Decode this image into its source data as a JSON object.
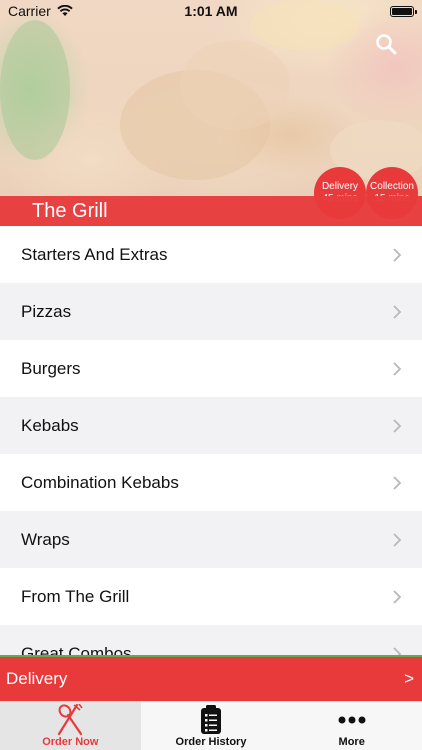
{
  "status_bar": {
    "carrier": "Carrier",
    "time": "1:01 AM"
  },
  "header": {
    "restaurant_name": "The Grill",
    "delivery_badge": {
      "label": "Delivery",
      "time": "45 mins"
    },
    "collection_badge": {
      "label": "Collection",
      "time": "15 mins"
    },
    "search_icon": "search-icon"
  },
  "menu": {
    "categories": [
      {
        "label": "Starters And Extras"
      },
      {
        "label": "Pizzas"
      },
      {
        "label": "Burgers"
      },
      {
        "label": "Kebabs"
      },
      {
        "label": "Combination Kebabs"
      },
      {
        "label": "Wraps"
      },
      {
        "label": "From The Grill"
      },
      {
        "label": "Great Combos"
      }
    ]
  },
  "order_bar": {
    "mode": "Delivery",
    "arrow": ">"
  },
  "tabs": [
    {
      "label": "Order Now",
      "icon": "cutlery-icon",
      "active": true
    },
    {
      "label": "Order History",
      "icon": "receipt-icon",
      "active": false
    },
    {
      "label": "More",
      "icon": "more-icon",
      "active": false
    }
  ],
  "colors": {
    "accent": "#e8393b",
    "divider": "#6aa84f",
    "row_alt": "#f2f2f4"
  }
}
